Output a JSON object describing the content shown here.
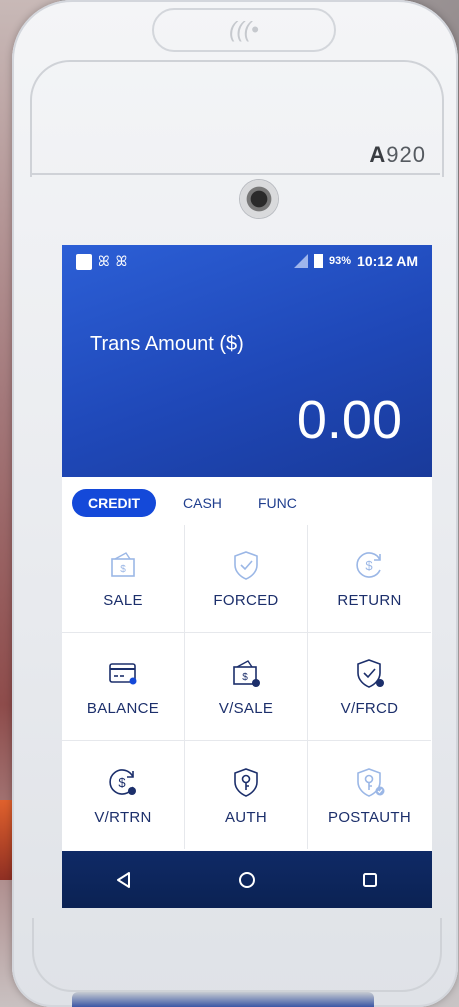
{
  "device": {
    "model_prefix": "A",
    "model_number": "920",
    "contactless_symbol": "(((•"
  },
  "status_bar": {
    "left_icons": [
      "notification-square-icon",
      "butterfly-icon",
      "butterfly-icon"
    ],
    "no_sim_icon": "no-sim-icon",
    "battery_percent": "93%",
    "time": "10:12 AM"
  },
  "hero": {
    "label": "Trans Amount ($)",
    "amount": "0.00",
    "gradient_top": "#2c5fd6",
    "gradient_bottom": "#193a9a"
  },
  "tabs": [
    {
      "label": "CREDIT",
      "active": true
    },
    {
      "label": "CASH",
      "active": false
    },
    {
      "label": "FUNC",
      "active": false
    }
  ],
  "functions": [
    {
      "label": "SALE",
      "icon": "wallet-dollar-icon"
    },
    {
      "label": "FORCED",
      "icon": "shield-check-icon"
    },
    {
      "label": "RETURN",
      "icon": "dollar-return-icon"
    },
    {
      "label": "BALANCE",
      "icon": "card-icon"
    },
    {
      "label": "V/SALE",
      "icon": "wallet-void-icon"
    },
    {
      "label": "V/FRCD",
      "icon": "shield-void-icon"
    },
    {
      "label": "V/RTRN",
      "icon": "dollar-void-icon"
    },
    {
      "label": "AUTH",
      "icon": "shield-key-icon"
    },
    {
      "label": "POSTAUTH",
      "icon": "shield-key-check-icon"
    }
  ],
  "navbar": {
    "back_icon": "back-triangle-icon",
    "home_icon": "home-circle-icon",
    "recents_icon": "recents-square-icon"
  },
  "colors": {
    "accent": "#1449d9",
    "label": "#1c2f6b",
    "icon_light": "#9bb7e6",
    "navbar": "#0f2a66"
  }
}
